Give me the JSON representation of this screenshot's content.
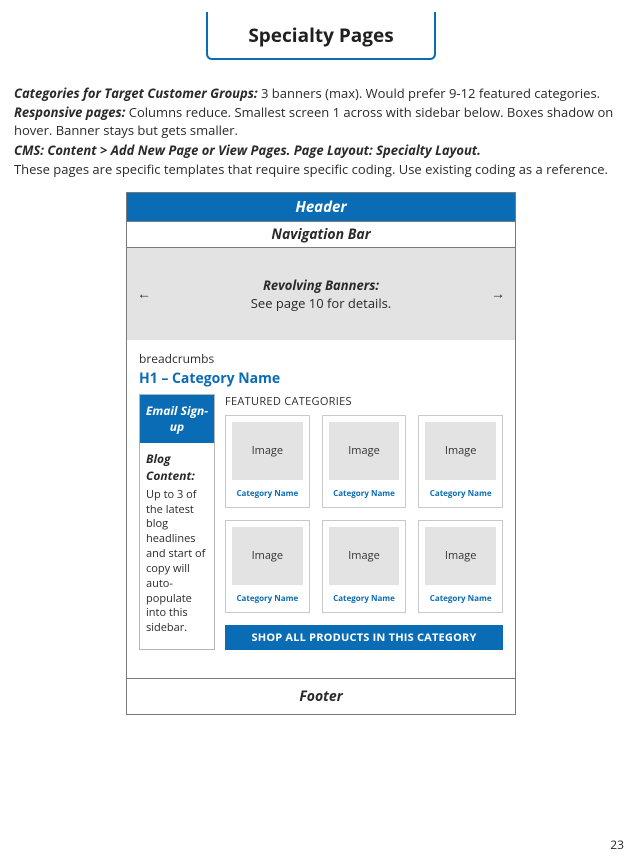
{
  "page_title": "Specialty Pages",
  "intro": {
    "line1_label": "Categories for Target Customer Groups:",
    "line1_rest": " 3 banners (max). Would prefer 9-12 featured categories.",
    "line2_label": "Responsive pages:",
    "line2_rest": " Columns reduce. Smallest screen 1 across with sidebar below. Boxes shadow on hover. Banner stays but gets smaller.",
    "line3_full": "CMS: Content > Add New Page or View Pages. Page Layout: Specialty Layout.",
    "line4": "These pages are specific templates that require specific coding. Use existing coding as a reference."
  },
  "mock": {
    "header": "Header",
    "nav": "Navigation Bar",
    "banner_title": "Revolving Banners:",
    "banner_sub": "See page 10 for details.",
    "arrow_left": "←",
    "arrow_right": "→",
    "breadcrumbs": "breadcrumbs",
    "h1": "H1 – Category Name",
    "featured_label": "FEATURED CATEGORIES",
    "sidebar": {
      "email_signup": "Email Sign-up",
      "blog_title": "Blog Content:",
      "blog_body": "Up to 3 of the latest blog headlines and start of copy will auto-populate into this sidebar."
    },
    "image_placeholder": "Image",
    "category_name": "Category Name",
    "shop_all": "SHOP ALL PRODUCTS IN THIS CATEGORY",
    "footer": "Footer"
  },
  "page_number": "23"
}
